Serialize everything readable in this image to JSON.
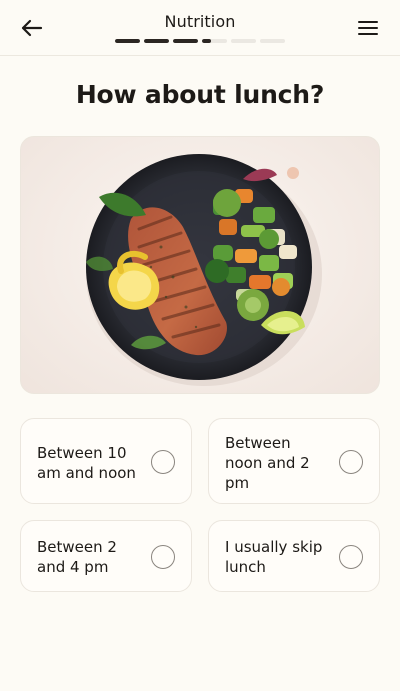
{
  "header": {
    "title": "Nutrition",
    "progress": [
      1,
      1,
      1,
      0.35,
      0,
      0
    ]
  },
  "question": "How about lunch?",
  "options": [
    {
      "label": "Between 10 am and noon"
    },
    {
      "label": "Between noon and 2 pm"
    },
    {
      "label": "Between 2 and 4 pm"
    },
    {
      "label": "I usually skip lunch"
    }
  ],
  "icons": {
    "back": "arrow-left-icon",
    "menu": "hamburger-menu-icon"
  },
  "colors": {
    "background": "#fdfbf5",
    "text": "#1d1a17",
    "progress_active": "#2b2622",
    "progress_inactive": "#ebe8e2"
  }
}
